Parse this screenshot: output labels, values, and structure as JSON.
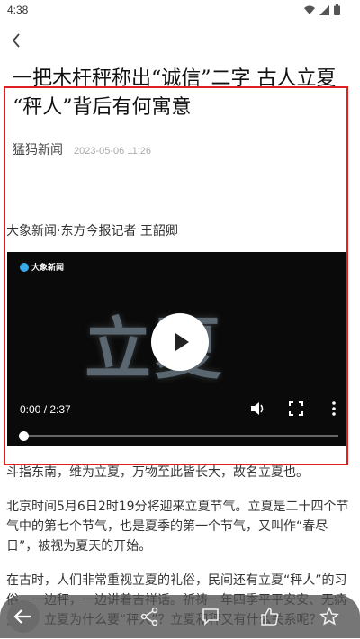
{
  "status_bar": {
    "time": "4:38"
  },
  "app_bar": {
    "back_icon": "chevron-left-icon"
  },
  "article": {
    "title_line1": "一把木杆秤称出“诚信”二字 古人立夏",
    "title_line2": "“秤人”背后有何寓意",
    "source": "猛犸新闻",
    "date": "2023-05-06 11:26",
    "reporter": "大象新闻·东方今报记者 王韶卿",
    "video": {
      "logo_text": "大象新闻",
      "art_text": "立夏",
      "time_display": "0:00 / 2:37",
      "progress": 0.0
    },
    "paragraphs": [
      "斗指东南，维为立夏，万物至此皆长大，故名立夏也。",
      "北京时间5月6日2时19分将迎来立夏节气。立夏是二十四个节气中的第七个节气，也是夏季的第一个节气，又叫作“春尽日”，被视为夏天的开始。",
      "在古时，人们非常重视立夏的礼俗，民间还有立夏“秤人”的习俗，一边秤，一边讲着吉祥话。祈祷一年四季平平安安、无病无灾。立夏为什么要“秤人”？立夏和秤又有什么关系呢？"
    ]
  },
  "bottom_bar": {
    "icons": [
      "back-arrow-icon",
      "share-icon",
      "comment-icon",
      "thumbs-up-icon",
      "star-icon"
    ]
  },
  "colors": {
    "highlight": "#e02020",
    "video_bg": "#0a0a0a",
    "logo_accent": "#38a9e8"
  }
}
